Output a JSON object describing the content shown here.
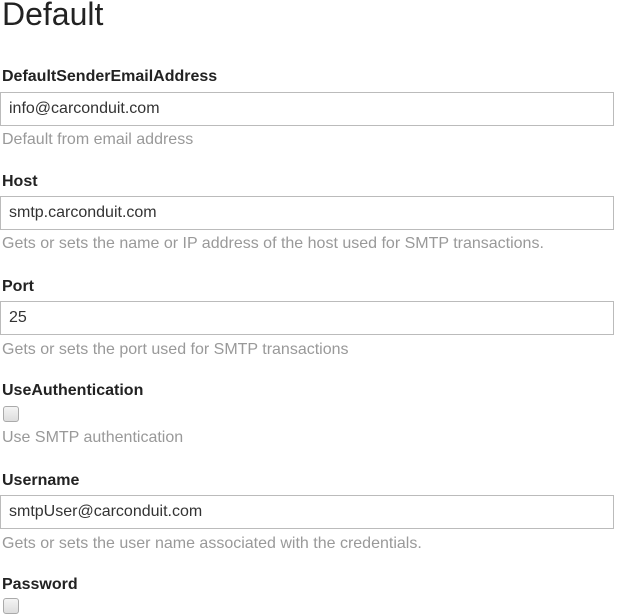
{
  "title": "Default",
  "fields": {
    "sender": {
      "label": "DefaultSenderEmailAddress",
      "value": "info@carconduit.com",
      "help": "Default from email address"
    },
    "host": {
      "label": "Host",
      "value": "smtp.carconduit.com",
      "help": "Gets or sets the name or IP address of the host used for SMTP transactions."
    },
    "port": {
      "label": "Port",
      "value": "25",
      "help": "Gets or sets the port used for SMTP transactions"
    },
    "auth": {
      "label": "UseAuthentication",
      "checked": false,
      "help": "Use SMTP authentication"
    },
    "username": {
      "label": "Username",
      "value": "smtpUser@carconduit.com",
      "help": "Gets or sets the user name associated with the credentials."
    },
    "password": {
      "label": "Password"
    }
  }
}
